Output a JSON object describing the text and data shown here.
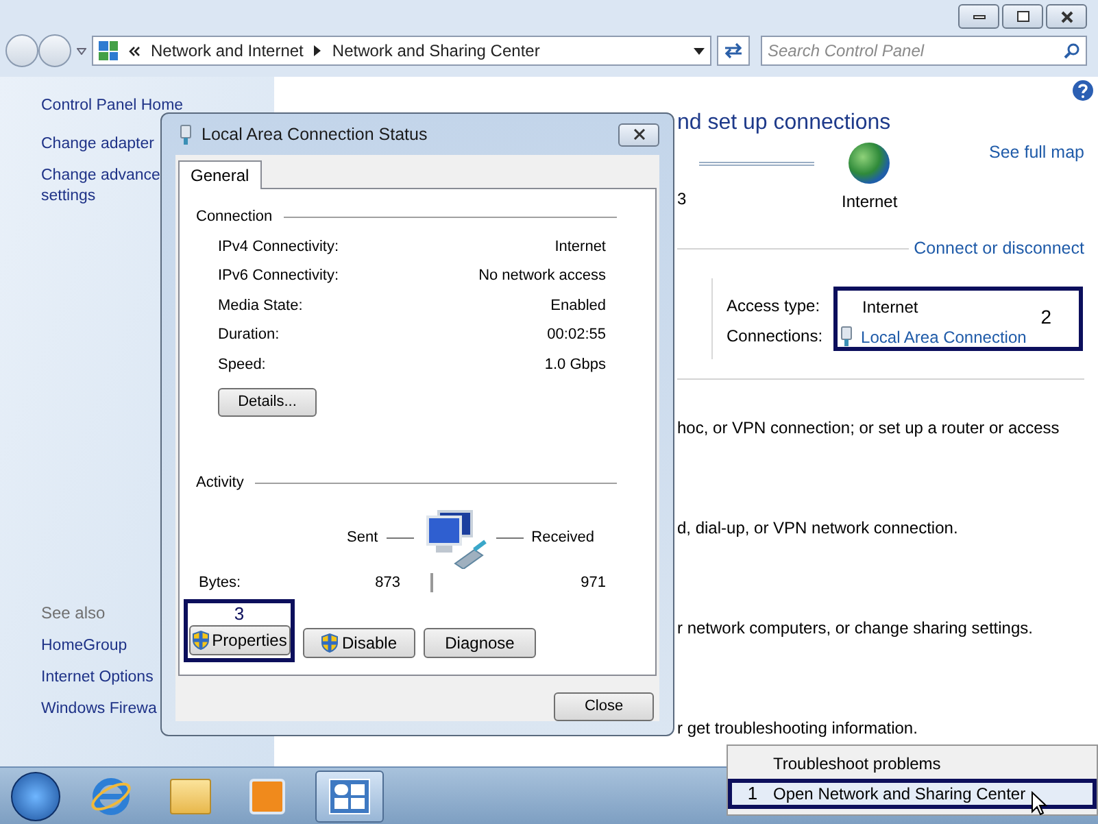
{
  "window": {
    "address": {
      "crumbs": [
        "Network and Internet",
        "Network and Sharing Center"
      ]
    },
    "search": {
      "placeholder": "Search Control Panel"
    }
  },
  "sidebar": {
    "links": [
      "Control Panel Home",
      "Change adapter",
      "Change advance\nsettings"
    ],
    "see_also_title": "See also",
    "see_also": [
      "HomeGroup",
      "Internet Options",
      "Windows Firewa"
    ]
  },
  "main": {
    "heading": "nd set up connections",
    "map_count": "3",
    "internet_label": "Internet",
    "see_full_map": "See full map",
    "connect_link": "Connect or disconnect",
    "access_type_label": "Access type:",
    "access_type_value": "Internet",
    "connections_label": "Connections:",
    "connection_link": "Local Area Connection",
    "callout": "2",
    "tasks": [
      "hoc, or VPN connection; or set up a router or access",
      "d, dial-up, or VPN network connection.",
      "r network computers, or change sharing settings.",
      "r get troubleshooting information."
    ]
  },
  "dialog": {
    "title": "Local Area Connection Status",
    "tabs": [
      {
        "label": "General",
        "selected": true
      }
    ],
    "connection_title": "Connection",
    "rows": [
      {
        "label": "IPv4 Connectivity:",
        "value": "Internet"
      },
      {
        "label": "IPv6 Connectivity:",
        "value": "No network access"
      },
      {
        "label": "Media State:",
        "value": "Enabled"
      },
      {
        "label": "Duration:",
        "value": "00:02:55"
      },
      {
        "label": "Speed:",
        "value": "1.0 Gbps"
      }
    ],
    "details_button": "Details...",
    "activity_title": "Activity",
    "sent_label": "Sent",
    "received_label": "Received",
    "bytes_label": "Bytes:",
    "bytes_sent": "873",
    "bytes_received": "971",
    "callout": "3",
    "buttons": [
      {
        "label": "Properties",
        "shield": true
      },
      {
        "label": "Disable",
        "shield": true
      },
      {
        "label": "Diagnose",
        "shield": false
      }
    ],
    "close_button": "Close"
  },
  "context_menu": {
    "items": [
      {
        "label": "Troubleshoot problems",
        "selected": false
      },
      {
        "label": "Open Network and Sharing Center",
        "selected": true,
        "callout": "1"
      }
    ]
  }
}
